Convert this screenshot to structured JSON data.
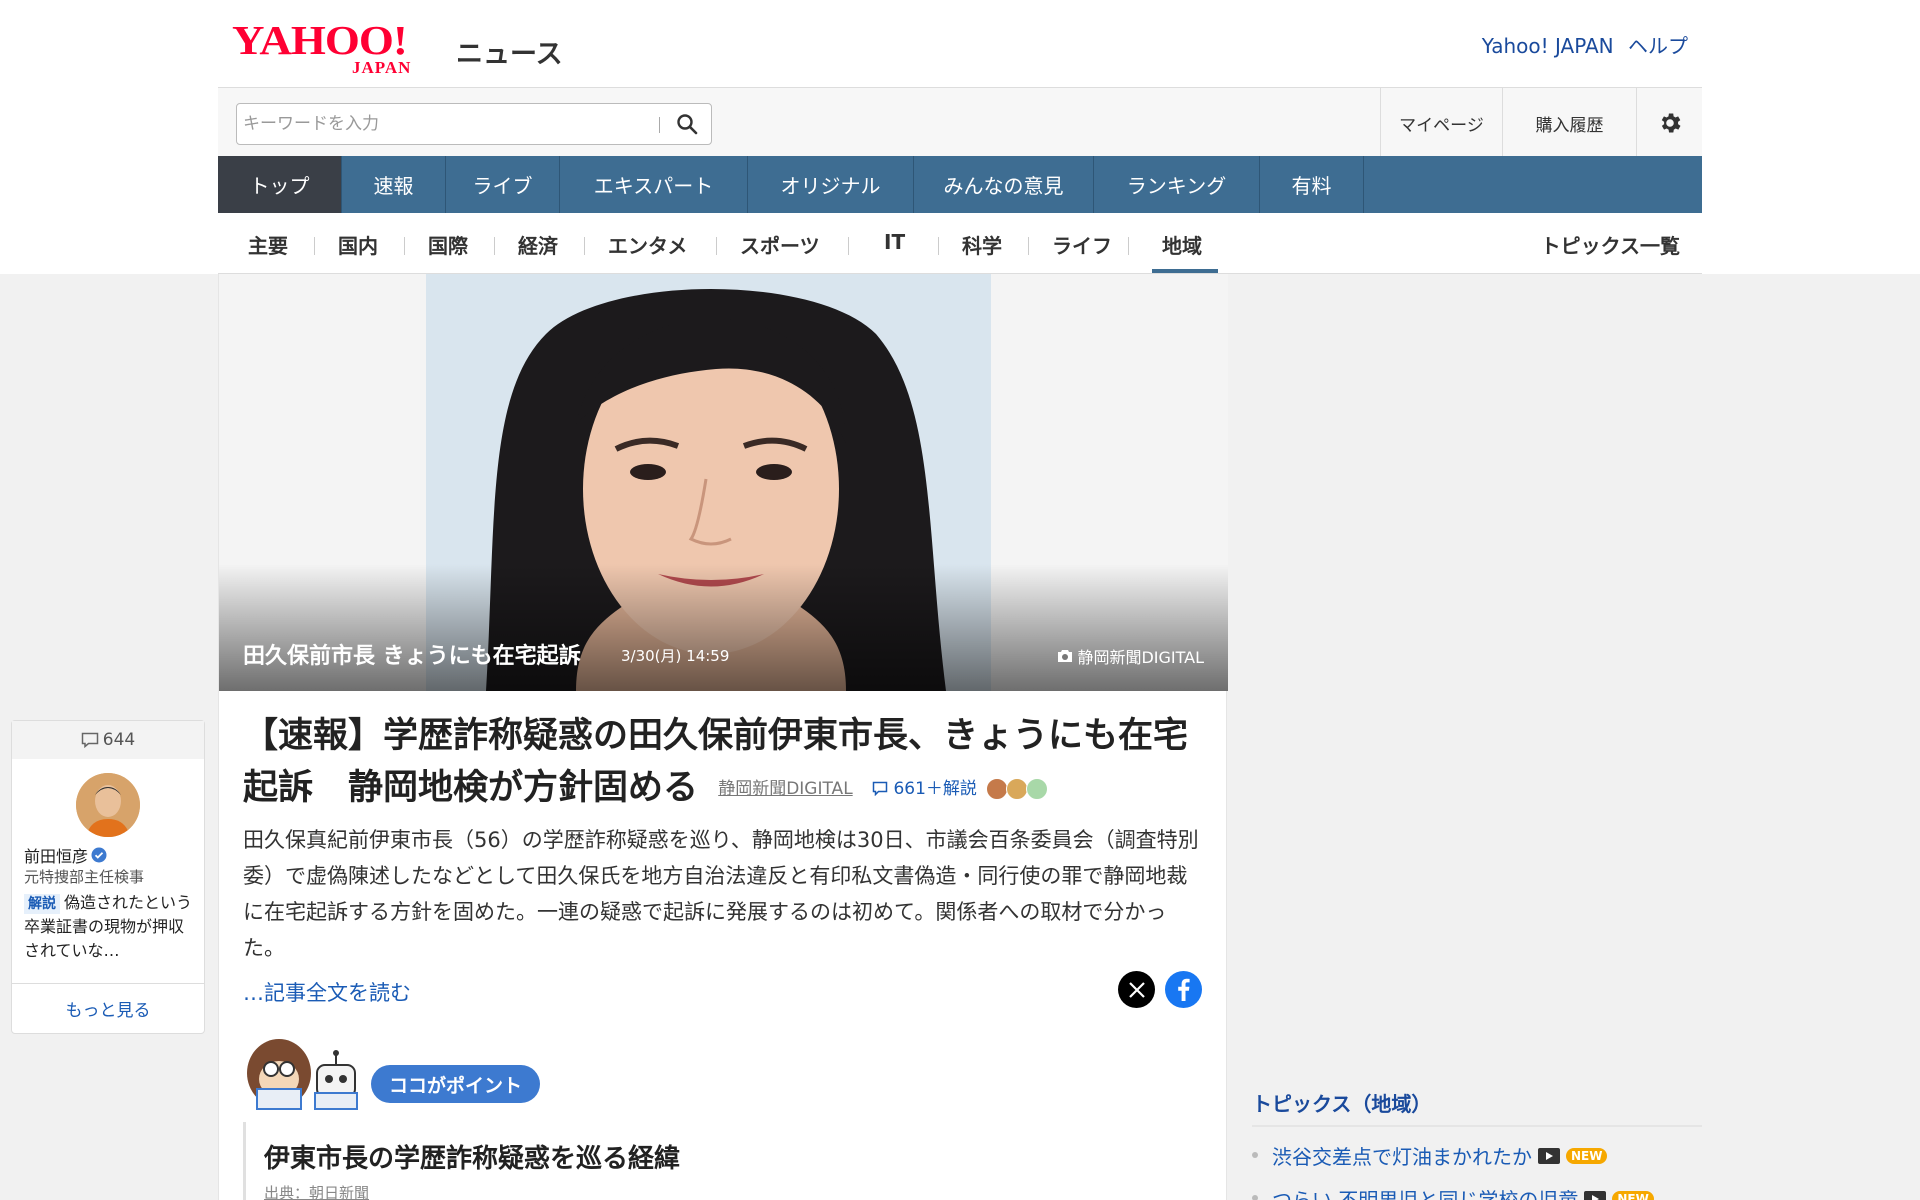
{
  "header": {
    "logo_text": "YAHOO!",
    "logo_sub": "JAPAN",
    "service_name": "ニュース",
    "links": [
      "Yahoo! JAPAN",
      "ヘルプ"
    ]
  },
  "search": {
    "placeholder": "キーワードを入力",
    "mypage_label": "マイページ",
    "history_label": "購入履歴"
  },
  "main_nav": {
    "items": [
      "トップ",
      "速報",
      "ライブ",
      "エキスパート",
      "オリジナル",
      "みんなの意見",
      "ランキング",
      "有料"
    ],
    "active": "トップ"
  },
  "sub_nav": {
    "items": [
      "主要",
      "国内",
      "国際",
      "経済",
      "エンタメ",
      "スポーツ",
      "IT",
      "科学",
      "ライフ",
      "地域"
    ],
    "active": "地域",
    "topics_link": "トピックス一覧"
  },
  "photo": {
    "caption_title": "田久保前市長 きょうにも在宅起訴",
    "caption_time": "3/30(月) 14:59",
    "caption_source": "静岡新聞DIGITAL"
  },
  "article": {
    "headline": "【速報】学歴詐称疑惑の田久保前伊東市長、きょうにも在宅起訴　静岡地検が方針固める",
    "source": "静岡新聞DIGITAL",
    "comments": "661＋解説",
    "summary": "田久保真紀前伊東市長（56）の学歴詐称疑惑を巡り、静岡地検は30日、市議会百条委員会（調査特別委）で虚偽陳述したなどとして田久保氏を地方自治法違反と有印私文書偽造・同行使の罪で静岡地裁に在宅起訴する方針を固めた。一連の疑惑で起訴に発展するのは初めて。関係者への取材で分かった。",
    "read_more": "…記事全文を読む"
  },
  "point": {
    "label": "ココがポイント",
    "title": "伊東市長の学歴詐称疑惑を巡る経緯",
    "source": "出典：朝日新聞"
  },
  "expert": {
    "count": "644",
    "name": "前田恒彦",
    "title": "元特捜部主任検事",
    "tag": "解説",
    "comment": "偽造されたという卒業証書の現物が押収されていな…",
    "more": "もっと見る"
  },
  "topics": {
    "title": "トピックス（地域）",
    "items": [
      {
        "text": "渋谷交差点で灯油まかれたか",
        "badge": "NEW"
      },
      {
        "text": "つらい 不明男児と同じ学校の児童",
        "badge": "NEW"
      }
    ]
  },
  "colors": {
    "nav_blue": "#3e6d92",
    "nav_active": "#3a3f47",
    "link_blue": "#1a5bb5",
    "brand_red": "#ff0033",
    "new_badge": "#f6a800"
  }
}
